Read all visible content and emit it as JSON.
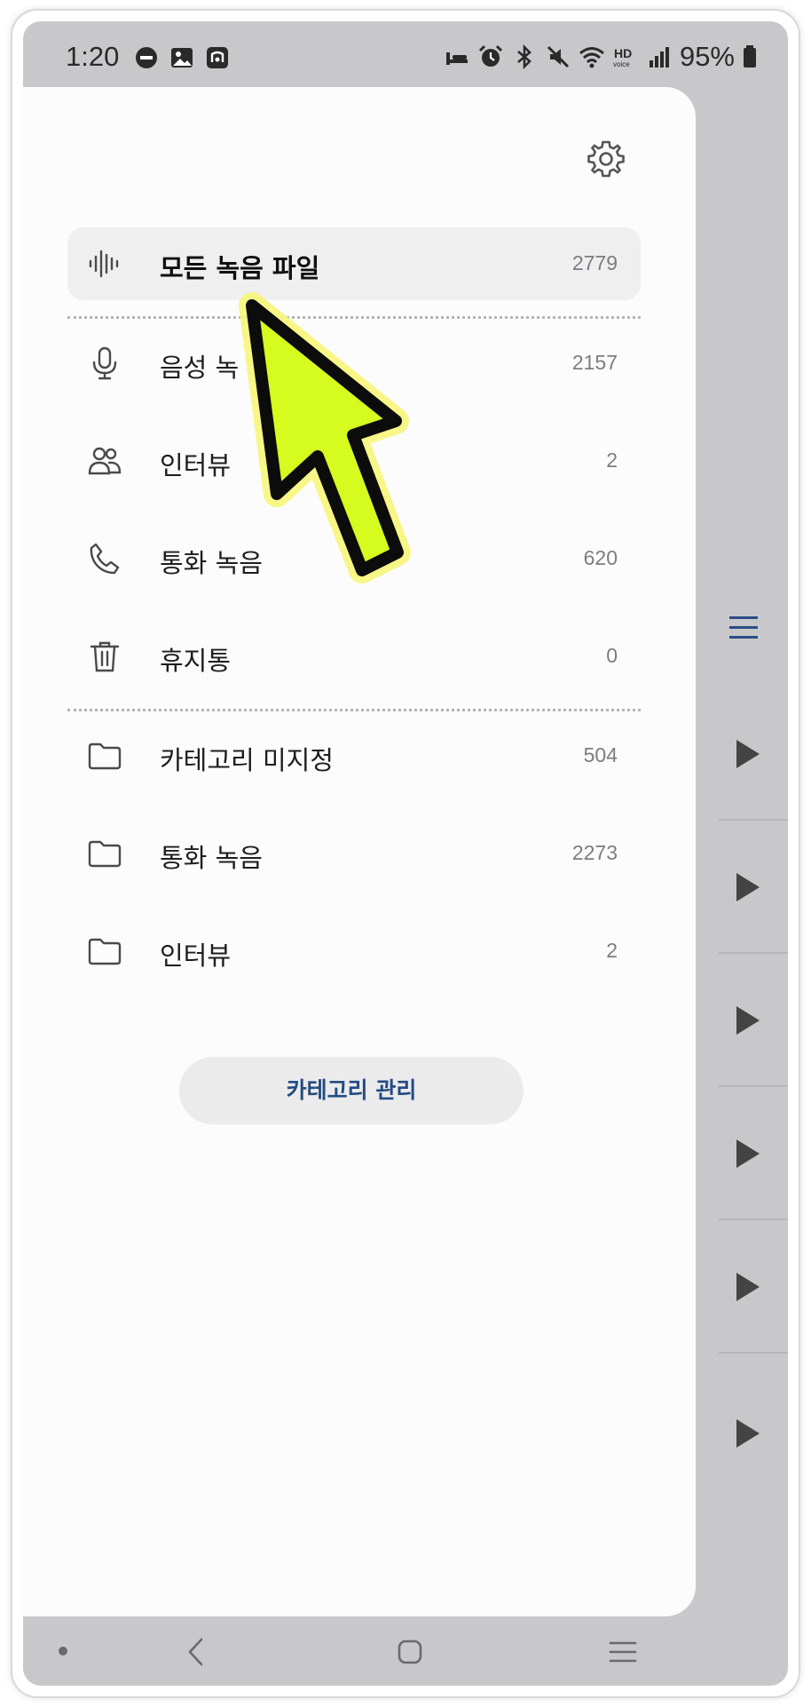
{
  "status_bar": {
    "time": "1:20",
    "battery": "95%",
    "left_icons": [
      "do-not-disturb-icon",
      "gallery-icon",
      "app-notification-icon"
    ],
    "right_icons": [
      "sleep-mode-icon",
      "alarm-icon",
      "bluetooth-icon",
      "mute-icon",
      "wifi-icon",
      "hd-voice-icon",
      "signal-icon",
      "battery-icon"
    ]
  },
  "drawer": {
    "settings_icon": "gear-icon",
    "items": [
      {
        "label": "모든 녹음 파일",
        "count": "2779",
        "icon": "waveform-icon",
        "selected": true
      },
      {
        "label": "음성 녹",
        "count": "2157",
        "icon": "microphone-icon"
      },
      {
        "label": "인터뷰",
        "count": "2",
        "icon": "people-icon"
      },
      {
        "label": "통화 녹음",
        "count": "620",
        "icon": "phone-icon"
      },
      {
        "label": "휴지통",
        "count": "0",
        "icon": "trash-icon"
      }
    ],
    "categories": [
      {
        "label": "카테고리 미지정",
        "count": "504",
        "icon": "folder-icon"
      },
      {
        "label": "통화 녹음",
        "count": "2273",
        "icon": "folder-icon"
      },
      {
        "label": "인터뷰",
        "count": "2",
        "icon": "folder-icon"
      }
    ],
    "manage_button": "카테고리 관리"
  },
  "background": {
    "menu_icon": "hamburger-icon",
    "play_icon": "play-icon",
    "accent": "#2a4e86"
  },
  "navbar": {
    "icons": [
      "nav-dot-icon",
      "back-icon",
      "home-icon",
      "recents-icon"
    ]
  },
  "annotation": {
    "pointer_color": "#d6fb1e",
    "pointer_glow": "#f7f57a"
  }
}
